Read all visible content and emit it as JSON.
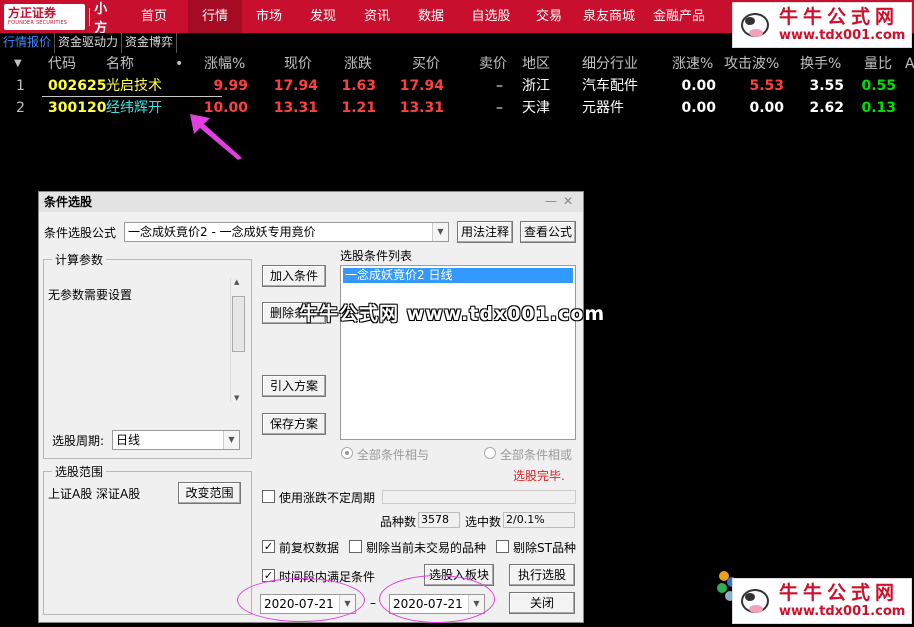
{
  "brand": {
    "name": "方正证券",
    "name_en": "FOUNDER SECURITIES",
    "sub": "小方"
  },
  "nav": [
    {
      "label": "首页"
    },
    {
      "label": "行情"
    },
    {
      "label": "市场"
    },
    {
      "label": "发现"
    },
    {
      "label": "资讯"
    },
    {
      "label": "数据"
    },
    {
      "label": "自选股"
    },
    {
      "label": "交易"
    },
    {
      "label": "泉友商城"
    },
    {
      "label": "金融产品"
    }
  ],
  "watermark": {
    "title": "牛牛公式网",
    "url": "www.tdx001.com",
    "center_text": "牛牛公式网 www.tdx001.com"
  },
  "subtabs": [
    {
      "label": "行情报价"
    },
    {
      "label": "资金驱动力"
    },
    {
      "label": "资金博弈"
    }
  ],
  "table": {
    "headers": {
      "sort": "▼",
      "code": "代码",
      "name": "名称",
      "dot": "•",
      "change_pct": "涨幅%",
      "price": "现价",
      "change": "涨跌",
      "bid": "买价",
      "ask": "卖价",
      "region": "地区",
      "industry": "细分行业",
      "speed": "涨速%",
      "attack": "攻击波%",
      "turnover": "换手%",
      "vol_ratio": "量比",
      "more": "A"
    },
    "rows": [
      {
        "idx": "1",
        "code": "002625",
        "name": "光启技术",
        "change_pct": "9.99",
        "price": "17.94",
        "change": "1.63",
        "bid": "17.94",
        "ask": "–",
        "region": "浙江",
        "industry": "汽车配件",
        "speed": "0.00",
        "attack": "5.53",
        "turnover": "3.55",
        "vol_ratio": "0.55"
      },
      {
        "idx": "2",
        "code": "300120",
        "name": "经纬辉开",
        "change_pct": "10.00",
        "price": "13.31",
        "change": "1.21",
        "bid": "13.31",
        "ask": "–",
        "region": "天津",
        "industry": "元器件",
        "speed": "0.00",
        "attack": "0.00",
        "turnover": "2.62",
        "vol_ratio": "0.13"
      }
    ]
  },
  "dialog": {
    "title": "条件选股",
    "formula_label": "条件选股公式",
    "formula_value": "一念成妖竟价2 - 一念成妖专用竟价",
    "usage_button": "用法注释",
    "view_button": "查看公式",
    "params_group": "计算参数",
    "params_text": "无参数需要设置",
    "period_label": "选股周期:",
    "period_value": "日线",
    "scope_group": "选股范围",
    "scope_text": "上证A股 深证A股",
    "change_scope_button": "改变范围",
    "add_button": "加入条件",
    "delete_button": "删除条件",
    "import_button": "引入方案",
    "save_button": "保存方案",
    "list_label": "选股条件列表",
    "list_items": [
      "一念成妖竟价2  日线"
    ],
    "radio_and": "全部条件相与",
    "radio_or": "全部条件相或",
    "status": "选股完毕.",
    "use_variable_period": "使用涨跌不定周期",
    "count_label": "品种数",
    "count_value": "3578",
    "selected_label": "选中数",
    "selected_value": "2/0.1%",
    "pre_adjust": "前复权数据",
    "exclude_untraded": "剔除当前未交易的品种",
    "exclude_st": "剔除ST品种",
    "time_range": "时间段内满足条件",
    "to_block_button": "选股入板块",
    "run_button": "执行选股",
    "close_button": "关闭",
    "date_from": "2020-07-21",
    "date_sep": "–",
    "date_to": "2020-07-21"
  }
}
